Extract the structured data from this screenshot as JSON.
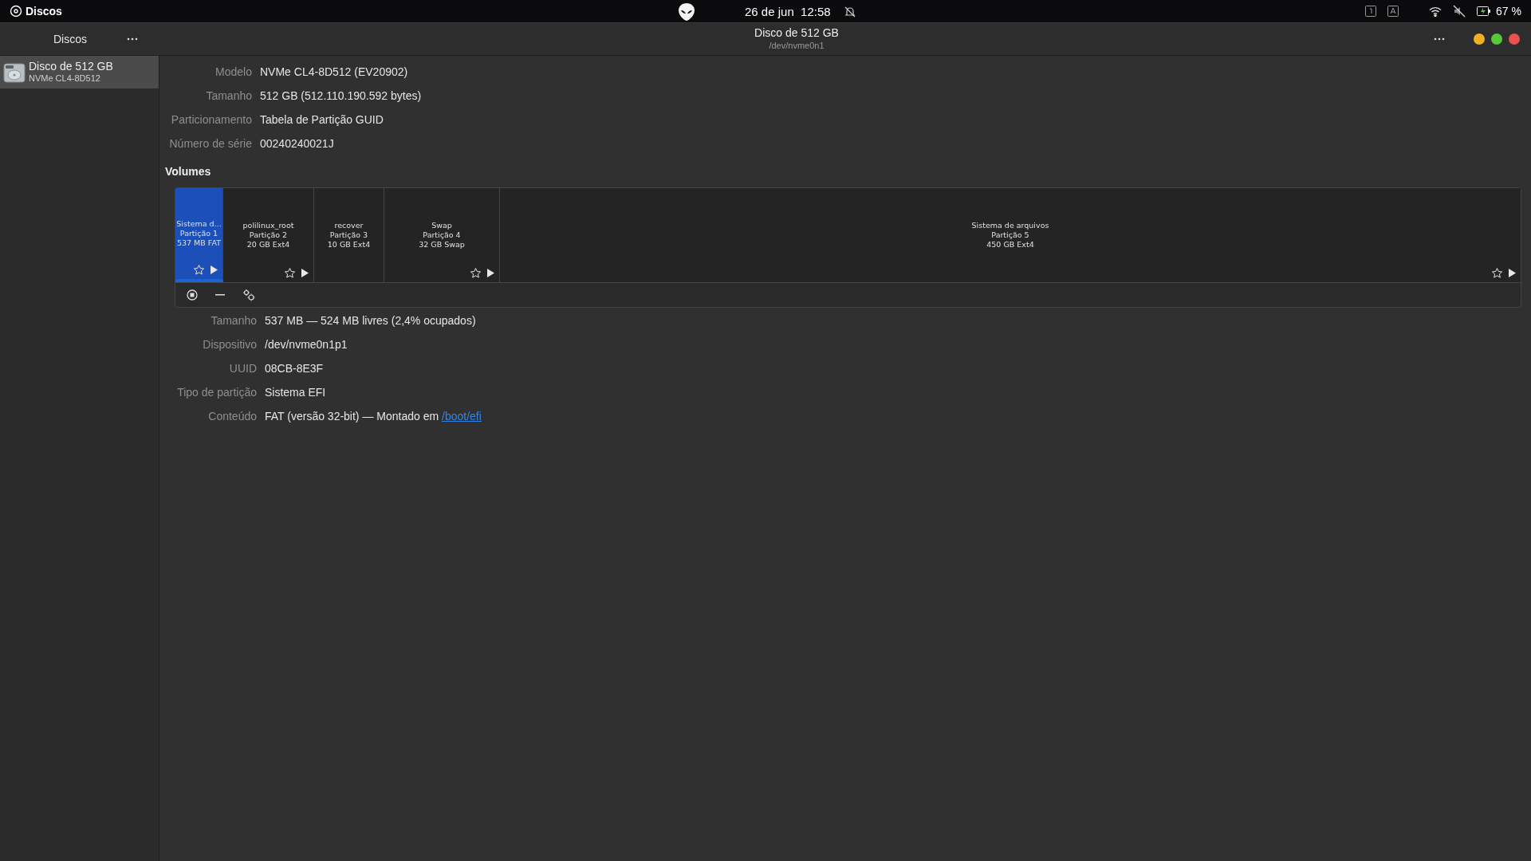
{
  "top_bar": {
    "app_name": "Discos",
    "clock": "26 de jun  12:58",
    "battery": "67 %"
  },
  "header": {
    "sidebar_title": "Discos",
    "title": "Disco de 512 GB",
    "subtitle": "/dev/nvme0n1"
  },
  "sidebar": {
    "items": [
      {
        "name": "Disco de 512 GB",
        "model": "NVMe CL4-8D512",
        "selected": true
      }
    ]
  },
  "disk_info": [
    {
      "label": "Modelo",
      "value": "NVMe CL4-8D512 (EV20902)"
    },
    {
      "label": "Tamanho",
      "value": "512 GB (512.110.190.592 bytes)"
    },
    {
      "label": "Particionamento",
      "value": "Tabela de Partição GUID"
    },
    {
      "label": "Número de série",
      "value": "00240240021J"
    }
  ],
  "volumes": {
    "title": "Volumes",
    "partitions": [
      {
        "lines": [
          "Sistema d...",
          "Partição 1",
          "537 MB FAT"
        ],
        "selected": true,
        "actions": true
      },
      {
        "lines": [
          "polilinux_root",
          "Partição 2",
          "20 GB Ext4"
        ],
        "selected": false,
        "actions": true
      },
      {
        "lines": [
          "recover",
          "Partição 3",
          "10 GB Ext4"
        ],
        "selected": false,
        "actions": false
      },
      {
        "lines": [
          "Swap",
          "Partição 4",
          "32 GB Swap"
        ],
        "selected": false,
        "actions": true
      },
      {
        "lines": [
          "Sistema de arquivos",
          "Partição 5",
          "450 GB Ext4"
        ],
        "selected": false,
        "actions": true
      }
    ]
  },
  "volume_info": [
    {
      "label": "Tamanho",
      "value": "537 MB — 524 MB livres (2,4% ocupados)"
    },
    {
      "label": "Dispositivo",
      "value": "/dev/nvme0n1p1"
    },
    {
      "label": "UUID",
      "value": "08CB-8E3F"
    },
    {
      "label": "Tipo de partição",
      "value": "Sistema EFI"
    },
    {
      "label": "Conteúdo",
      "value": "FAT (versão 32-bit) — Montado em ",
      "link": "/boot/efi"
    }
  ]
}
